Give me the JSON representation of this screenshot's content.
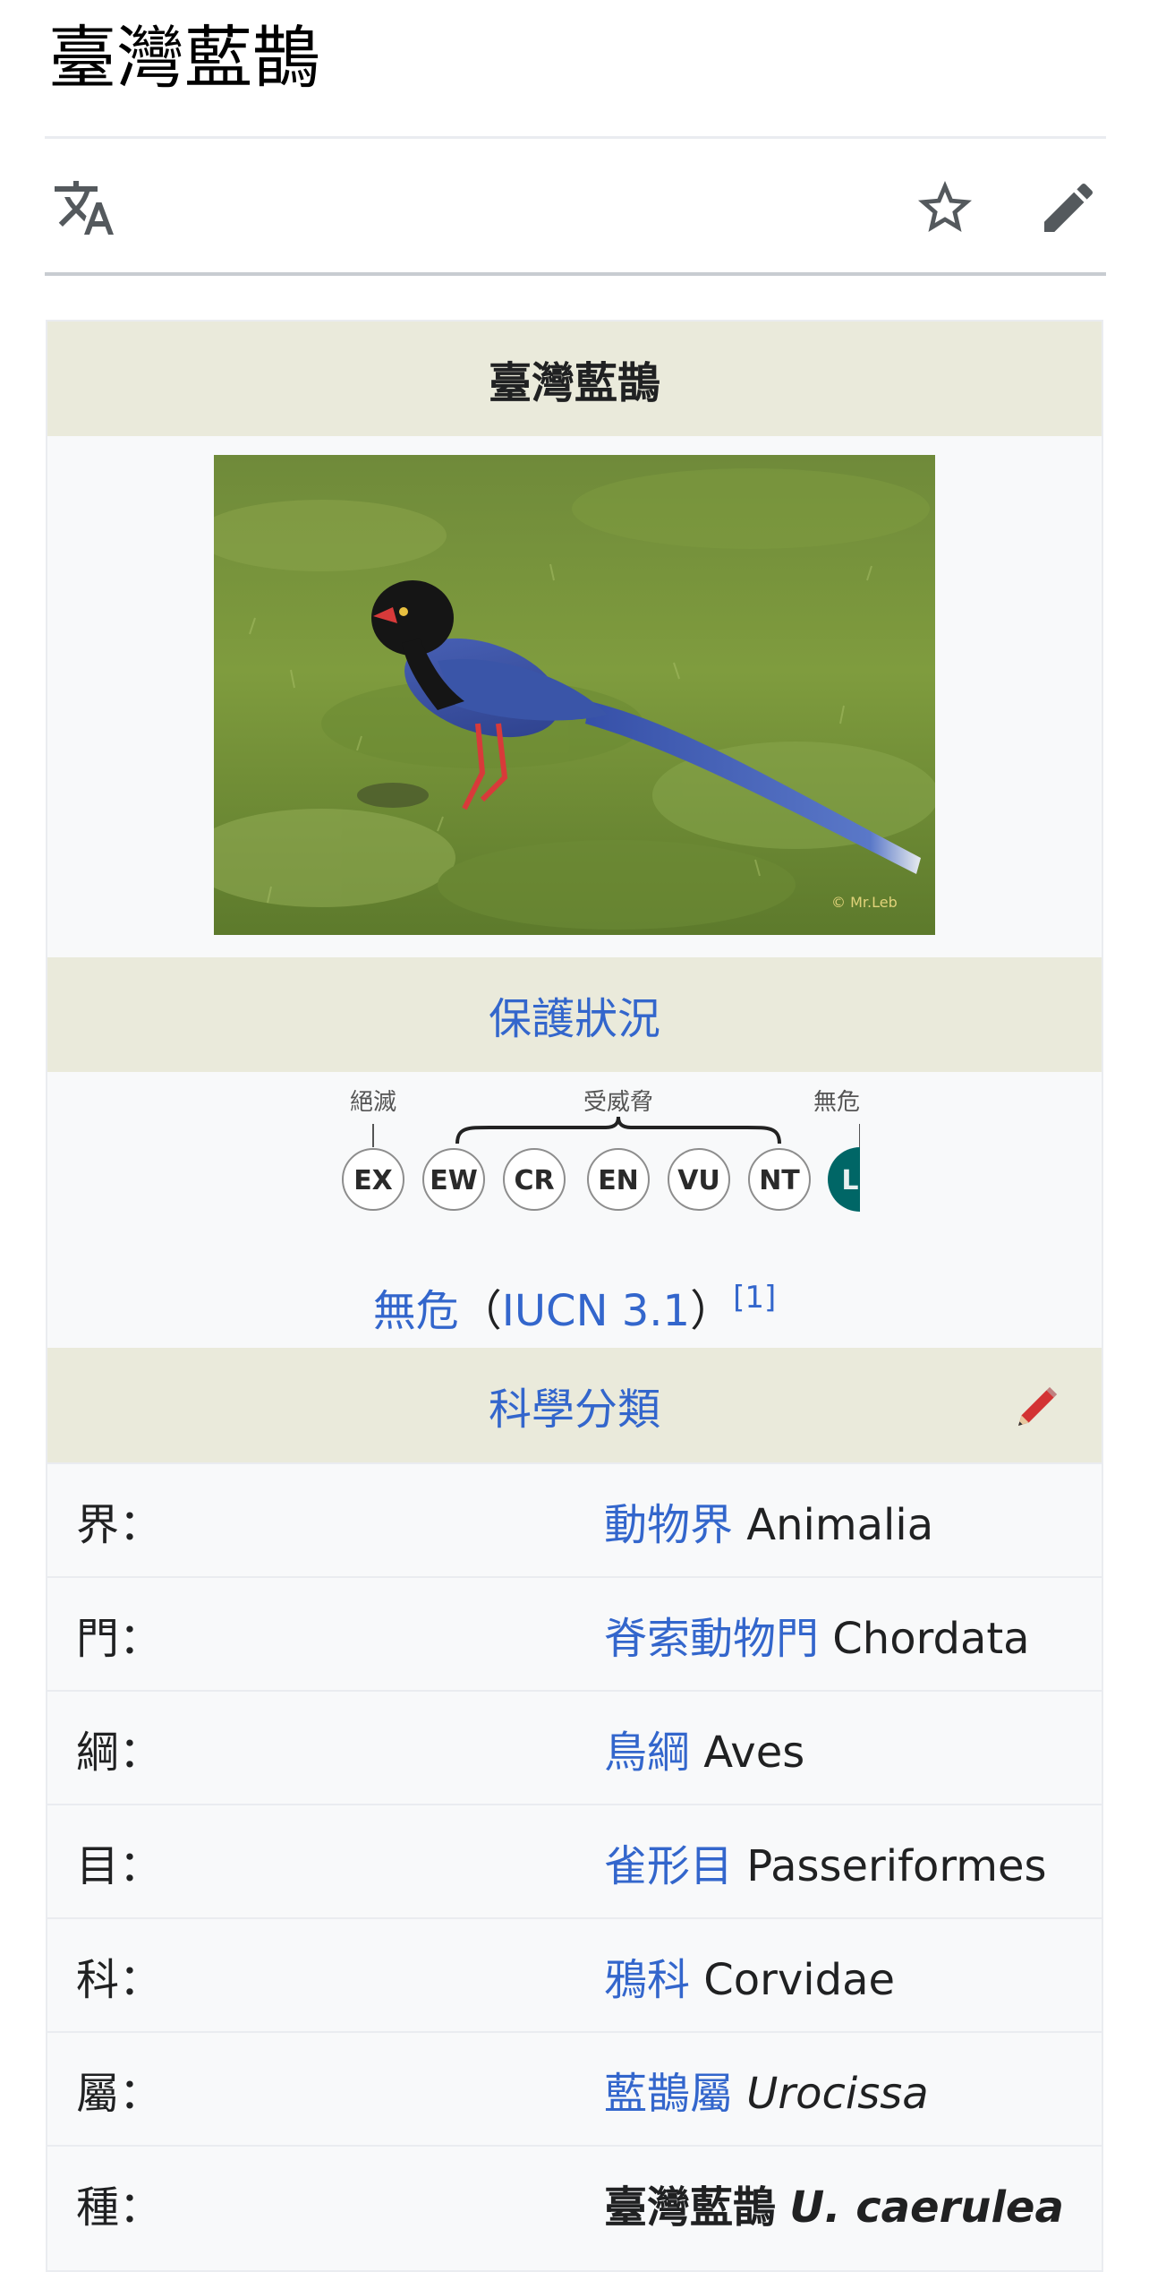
{
  "page": {
    "title": "臺灣藍鵲"
  },
  "toolbar": {
    "language_icon": "translate-icon",
    "watch_icon": "star-outline-icon",
    "edit_icon": "pencil-icon"
  },
  "infobox": {
    "name": "臺灣藍鵲",
    "photo_watermark": "© Mr.Leb",
    "status_heading": "保護狀況",
    "status_scale": {
      "group_extinct": "絕滅",
      "group_threatened": "受威脅",
      "group_lc": "無危",
      "categories": [
        "EX",
        "EW",
        "CR",
        "EN",
        "VU",
        "NT",
        "LC"
      ],
      "active": "LC"
    },
    "status_text": "無危",
    "status_open": "（",
    "status_source": "IUCN 3.1",
    "status_close": "）",
    "status_ref": "[1]",
    "taxo_heading": "科學分類",
    "taxonomy": [
      {
        "rank": "界：",
        "link": "動物界",
        "sci": "Animalia"
      },
      {
        "rank": "門：",
        "link": "脊索動物門",
        "sci": "Chordata"
      },
      {
        "rank": "綱：",
        "link": "鳥綱",
        "sci": "Aves"
      },
      {
        "rank": "目：",
        "link": "雀形目",
        "sci": "Passeriformes"
      },
      {
        "rank": "科：",
        "link": "鴉科",
        "sci": "Corvidae"
      },
      {
        "rank": "屬：",
        "link": "藍鵲屬",
        "sci": "Urocissa"
      },
      {
        "rank": "種：",
        "name": "臺灣藍鵲",
        "sci": "U. caerulea"
      }
    ]
  },
  "colors": {
    "link": "#3366cc",
    "header_bg": "#eaeadb",
    "box_bg": "#f8f9fa",
    "lc_fill": "#006666"
  }
}
